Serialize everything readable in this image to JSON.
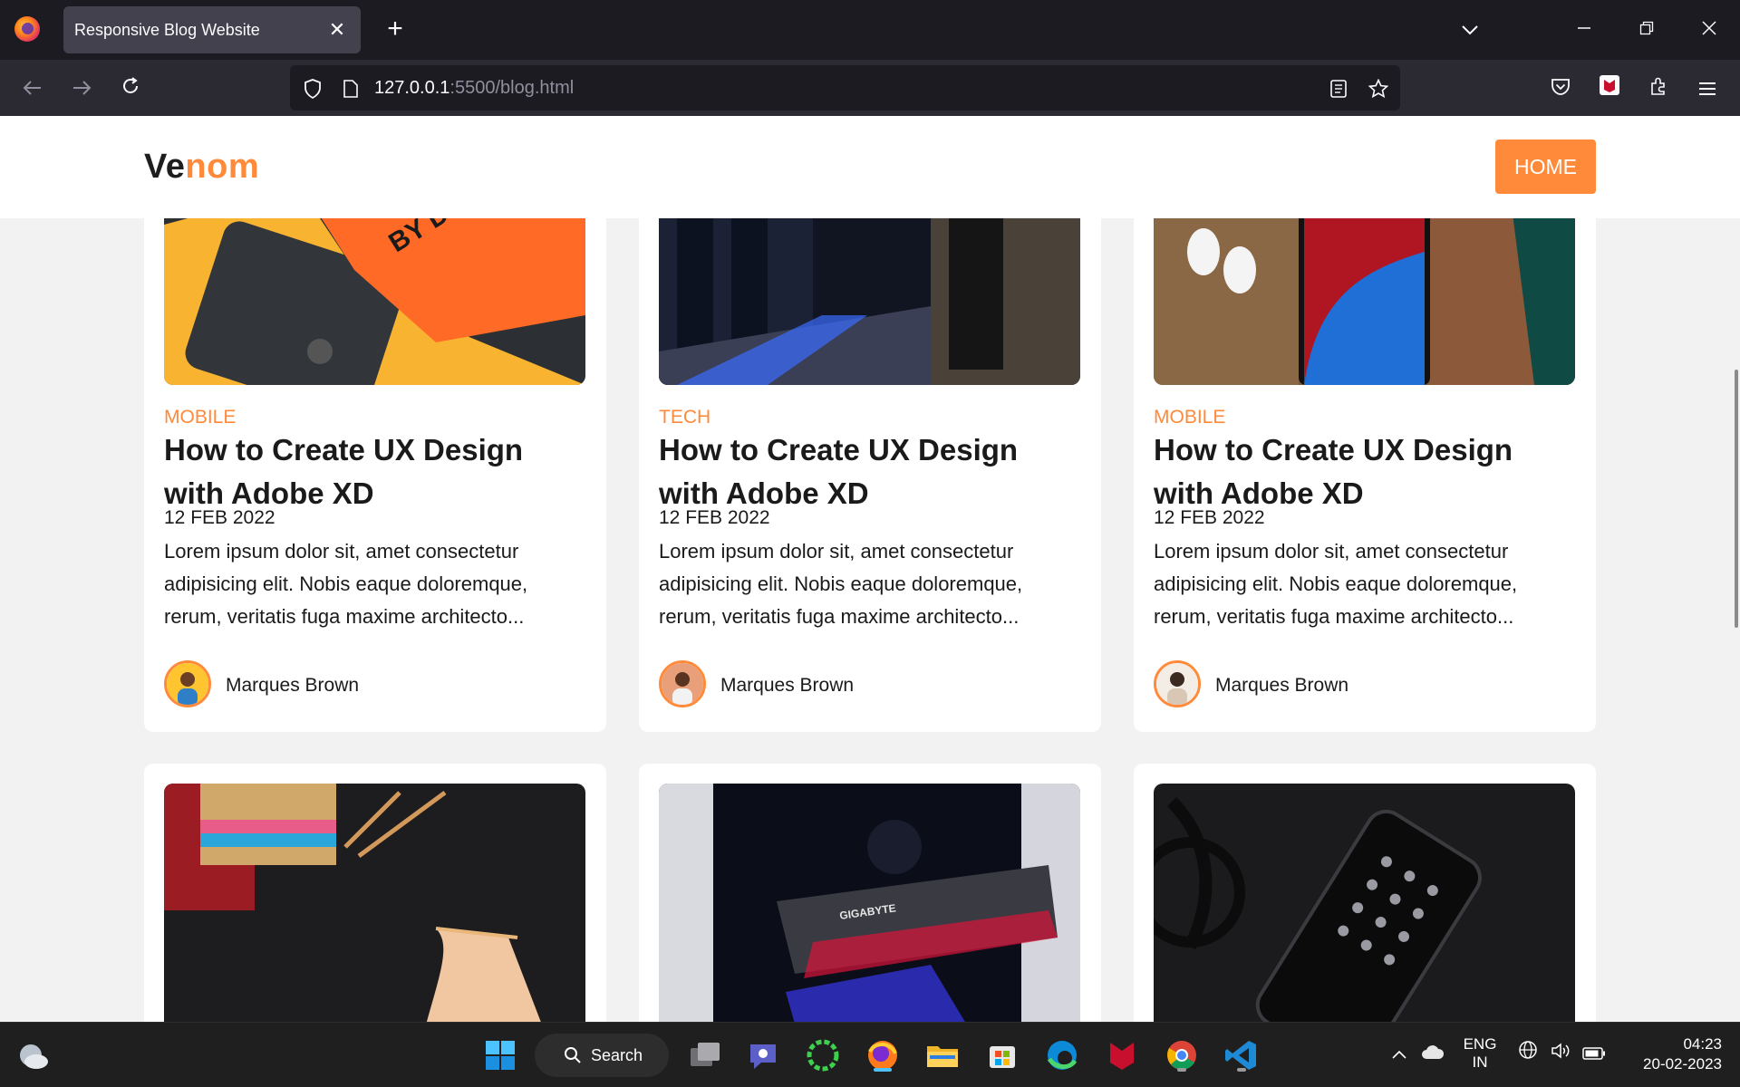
{
  "browser": {
    "tab_title": "Responsive Blog Website",
    "url_host": "127.0.0.1",
    "url_rest": ":5500/blog.html"
  },
  "site": {
    "logo_dark": "Ve",
    "logo_accent": "nom",
    "home_label": "HOME",
    "accent_color": "#ff8a3a"
  },
  "cards_top": [
    {
      "category": "MOBILE",
      "title": "How to Create UX Design with Adobe XD",
      "date": "12 FEB 2022",
      "excerpt": "Lorem ipsum dolor sit, amet consectetur adipisicing elit. Nobis eaque doloremque, rerum, veritatis fuga maxime architecto...",
      "author": "Marques Brown"
    },
    {
      "category": "TECH",
      "title": "How to Create UX Design with Adobe XD",
      "date": "12 FEB 2022",
      "excerpt": "Lorem ipsum dolor sit, amet consectetur adipisicing elit. Nobis eaque doloremque, rerum, veritatis fuga maxime architecto...",
      "author": "Marques Brown"
    },
    {
      "category": "MOBILE",
      "title": "How to Create UX Design with Adobe XD",
      "date": "12 FEB 2022",
      "excerpt": "Lorem ipsum dolor sit, amet consectetur adipisicing elit. Nobis eaque doloremque, rerum, veritatis fuga maxime architecto...",
      "author": "Marques Brown"
    }
  ],
  "taskbar": {
    "search_label": "Search",
    "lang_top": "ENG",
    "lang_bottom": "IN",
    "time": "04:23",
    "date": "20-02-2023"
  }
}
